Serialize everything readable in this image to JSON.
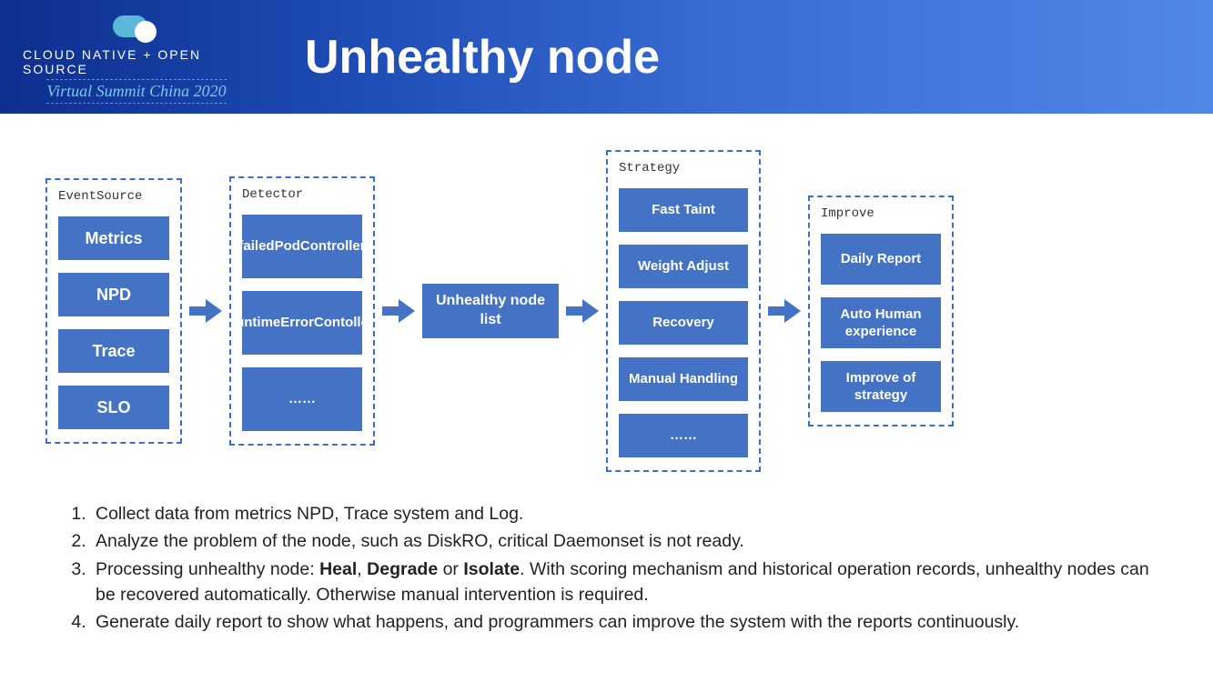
{
  "header": {
    "logo_line1": "CLOUD NATIVE + OPEN SOURCE",
    "logo_line2": "Virtual Summit China 2020",
    "title": "Unhealthy node"
  },
  "diagram": {
    "groups": {
      "event": {
        "title": "EventSource",
        "items": [
          "Metrics",
          "NPD",
          "Trace",
          "SLO"
        ]
      },
      "detector": {
        "title": "Detector",
        "items": [
          "failedPodController",
          "runtimeErrorContoller",
          "……"
        ]
      },
      "center": "Unhealthy node list",
      "strategy": {
        "title": "Strategy",
        "items": [
          "Fast Taint",
          "Weight Adjust",
          "Recovery",
          "Manual Handling",
          "……"
        ]
      },
      "improve": {
        "title": "Improve",
        "items": [
          "Daily Report",
          "Auto Human experience",
          "Improve of strategy"
        ]
      }
    }
  },
  "notes": {
    "n1": "Collect data from metrics NPD, Trace system and Log.",
    "n2": "Analyze the problem of the node, such as DiskRO, critical Daemonset is not ready.",
    "n3a": "Processing unhealthy node: ",
    "n3b1": "Heal",
    "n3s1": ", ",
    "n3b2": "Degrade",
    "n3s2": " or ",
    "n3b3": "Isolate",
    "n3c": ". With scoring mechanism and historical operation records, unhealthy nodes can be recovered automatically. Otherwise manual intervention is required.",
    "n4": "Generate daily report to show what happens, and programmers can improve the system with the reports continuously."
  }
}
